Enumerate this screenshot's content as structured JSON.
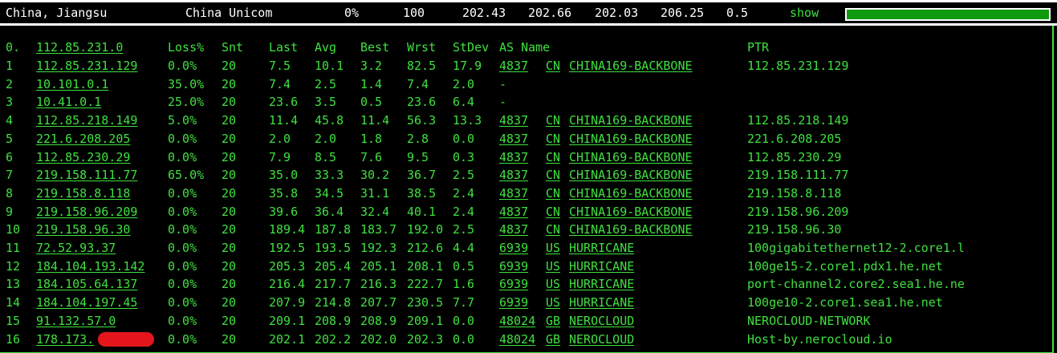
{
  "summary": {
    "location": "China, Jiangsu",
    "isp": "China Unicom",
    "loss": "0%",
    "sent": "100",
    "last": "202.43",
    "avg": "202.66",
    "best": "202.03",
    "worst": "206.25",
    "stdev": "0.5",
    "show_label": "show",
    "progress": 1.0
  },
  "table": {
    "headers": {
      "num": "0.",
      "host": "112.85.231.0",
      "loss": "Loss%",
      "snt": "Snt",
      "last": "Last",
      "avg": "Avg",
      "best": "Best",
      "wrst": "Wrst",
      "stdev": "StDev",
      "asname": "AS Name",
      "ptr": "PTR"
    },
    "rows": [
      {
        "num": "1",
        "host": "112.85.231.129",
        "loss": "0.0%",
        "snt": "20",
        "last": "7.5",
        "avg": "10.1",
        "best": "3.2",
        "wrst": "82.5",
        "stdev": "17.9",
        "asn": "4837",
        "cc": "CN",
        "asname": "CHINA169-BACKBONE",
        "ptr": "112.85.231.129"
      },
      {
        "num": "2",
        "host": "10.101.0.1",
        "loss": "35.0%",
        "snt": "20",
        "last": "7.4",
        "avg": "2.5",
        "best": "1.4",
        "wrst": "7.4",
        "stdev": "2.0",
        "asn": "-",
        "cc": "",
        "asname": "",
        "ptr": ""
      },
      {
        "num": "3",
        "host": "10.41.0.1",
        "loss": "25.0%",
        "snt": "20",
        "last": "23.6",
        "avg": "3.5",
        "best": "0.5",
        "wrst": "23.6",
        "stdev": "6.4",
        "asn": "-",
        "cc": "",
        "asname": "",
        "ptr": ""
      },
      {
        "num": "4",
        "host": "112.85.218.149",
        "loss": "5.0%",
        "snt": "20",
        "last": "11.4",
        "avg": "45.8",
        "best": "11.4",
        "wrst": "56.3",
        "stdev": "13.3",
        "asn": "4837",
        "cc": "CN",
        "asname": "CHINA169-BACKBONE",
        "ptr": "112.85.218.149"
      },
      {
        "num": "5",
        "host": "221.6.208.205",
        "loss": "0.0%",
        "snt": "20",
        "last": "2.0",
        "avg": "2.0",
        "best": "1.8",
        "wrst": "2.8",
        "stdev": "0.0",
        "asn": "4837",
        "cc": "CN",
        "asname": "CHINA169-BACKBONE",
        "ptr": "221.6.208.205"
      },
      {
        "num": "6",
        "host": "112.85.230.29",
        "loss": "0.0%",
        "snt": "20",
        "last": "7.9",
        "avg": "8.5",
        "best": "7.6",
        "wrst": "9.5",
        "stdev": "0.3",
        "asn": "4837",
        "cc": "CN",
        "asname": "CHINA169-BACKBONE",
        "ptr": "112.85.230.29"
      },
      {
        "num": "7",
        "host": "219.158.111.77",
        "loss": "65.0%",
        "snt": "20",
        "last": "35.0",
        "avg": "33.3",
        "best": "30.2",
        "wrst": "36.7",
        "stdev": "2.5",
        "asn": "4837",
        "cc": "CN",
        "asname": "CHINA169-BACKBONE",
        "ptr": "219.158.111.77"
      },
      {
        "num": "8",
        "host": "219.158.8.118",
        "loss": "0.0%",
        "snt": "20",
        "last": "35.8",
        "avg": "34.5",
        "best": "31.1",
        "wrst": "38.5",
        "stdev": "2.4",
        "asn": "4837",
        "cc": "CN",
        "asname": "CHINA169-BACKBONE",
        "ptr": "219.158.8.118"
      },
      {
        "num": "9",
        "host": "219.158.96.209",
        "loss": "0.0%",
        "snt": "20",
        "last": "39.6",
        "avg": "36.4",
        "best": "32.4",
        "wrst": "40.1",
        "stdev": "2.4",
        "asn": "4837",
        "cc": "CN",
        "asname": "CHINA169-BACKBONE",
        "ptr": "219.158.96.209"
      },
      {
        "num": "10",
        "host": "219.158.96.30",
        "loss": "0.0%",
        "snt": "20",
        "last": "189.4",
        "avg": "187.8",
        "best": "183.7",
        "wrst": "192.0",
        "stdev": "2.5",
        "asn": "4837",
        "cc": "CN",
        "asname": "CHINA169-BACKBONE",
        "ptr": "219.158.96.30"
      },
      {
        "num": "11",
        "host": "72.52.93.37",
        "loss": "0.0%",
        "snt": "20",
        "last": "192.5",
        "avg": "193.5",
        "best": "192.3",
        "wrst": "212.6",
        "stdev": "4.4",
        "asn": "6939",
        "cc": "US",
        "asname": "HURRICANE",
        "ptr": "100gigabitethernet12-2.core1.l"
      },
      {
        "num": "12",
        "host": "184.104.193.142",
        "loss": "0.0%",
        "snt": "20",
        "last": "205.3",
        "avg": "205.4",
        "best": "205.1",
        "wrst": "208.1",
        "stdev": "0.5",
        "asn": "6939",
        "cc": "US",
        "asname": "HURRICANE",
        "ptr": "100ge15-2.core1.pdx1.he.net"
      },
      {
        "num": "13",
        "host": "184.105.64.137",
        "loss": "0.0%",
        "snt": "20",
        "last": "216.4",
        "avg": "217.7",
        "best": "216.3",
        "wrst": "222.7",
        "stdev": "1.6",
        "asn": "6939",
        "cc": "US",
        "asname": "HURRICANE",
        "ptr": "port-channel2.core2.sea1.he.ne"
      },
      {
        "num": "14",
        "host": "184.104.197.45",
        "loss": "0.0%",
        "snt": "20",
        "last": "207.9",
        "avg": "214.8",
        "best": "207.7",
        "wrst": "230.5",
        "stdev": "7.7",
        "asn": "6939",
        "cc": "US",
        "asname": "HURRICANE",
        "ptr": "100ge10-2.core1.sea1.he.net"
      },
      {
        "num": "15",
        "host": "91.132.57.0",
        "loss": "0.0%",
        "snt": "20",
        "last": "209.1",
        "avg": "208.9",
        "best": "208.9",
        "wrst": "209.1",
        "stdev": "0.0",
        "asn": "48024",
        "cc": "GB",
        "asname": "NEROCLOUD",
        "ptr": "NEROCLOUD-NETWORK"
      },
      {
        "num": "16",
        "host": "178.173.",
        "loss": "0.0%",
        "snt": "20",
        "last": "202.1",
        "avg": "202.2",
        "best": "202.0",
        "wrst": "202.3",
        "stdev": "0.0",
        "asn": "48024",
        "cc": "GB",
        "asname": "NEROCLOUD",
        "ptr": "Host-by.nerocloud.io",
        "redacted": true
      }
    ]
  }
}
